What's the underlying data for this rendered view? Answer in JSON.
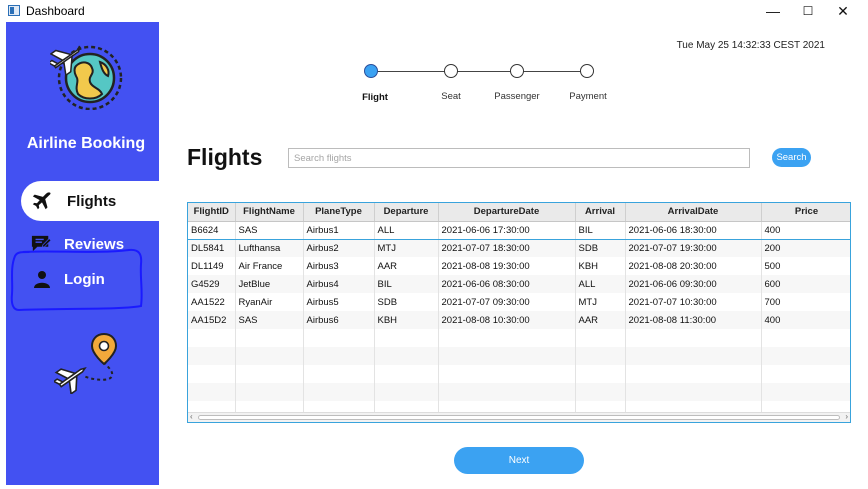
{
  "window": {
    "title": "Dashboard",
    "minimize": "—",
    "maximize": "☐",
    "close": "✕"
  },
  "sidebar": {
    "brand": "Airline Booking",
    "items": [
      {
        "label": "Flights",
        "icon": "plane-icon",
        "active": true
      },
      {
        "label": "Reviews",
        "icon": "reviews-icon",
        "active": false
      },
      {
        "label": "Login",
        "icon": "user-icon",
        "active": false
      }
    ],
    "colors": {
      "background": "#4351f2",
      "active_bg": "#ffffff"
    }
  },
  "header": {
    "datetime": "Tue May 25 14:32:33 CEST 2021"
  },
  "stepper": {
    "steps": [
      {
        "label": "Flight",
        "active": true
      },
      {
        "label": "Seat",
        "active": false
      },
      {
        "label": "Passenger",
        "active": false
      },
      {
        "label": "Payment",
        "active": false
      }
    ]
  },
  "main": {
    "title": "Flights",
    "search": {
      "placeholder": "Search flights",
      "value": "",
      "button_label": "Search"
    },
    "next_label": "Next"
  },
  "table": {
    "columns": [
      "FlightID",
      "FlightName",
      "PlaneType",
      "Departure",
      "DepartureDate",
      "Arrival",
      "ArrivalDate",
      "Price"
    ],
    "rows": [
      [
        "B6624",
        "SAS",
        "Airbus1",
        "ALL",
        "2021-06-06 17:30:00",
        "BIL",
        "2021-06-06 18:30:00",
        "400"
      ],
      [
        "DL5841",
        "Lufthansa",
        "Airbus2",
        "MTJ",
        "2021-07-07 18:30:00",
        "SDB",
        "2021-07-07 19:30:00",
        "200"
      ],
      [
        "DL1149",
        "Air France",
        "Airbus3",
        "AAR",
        "2021-08-08 19:30:00",
        "KBH",
        "2021-08-08 20:30:00",
        "500"
      ],
      [
        "G4529",
        "JetBlue",
        "Airbus4",
        "BIL",
        "2021-06-06 08:30:00",
        "ALL",
        "2021-06-06 09:30:00",
        "600"
      ],
      [
        "AA1522",
        "RyanAir",
        "Airbus5",
        "SDB",
        "2021-07-07 09:30:00",
        "MTJ",
        "2021-07-07 10:30:00",
        "700"
      ],
      [
        "AA15D2",
        "SAS",
        "Airbus6",
        "KBH",
        "2021-08-08 10:30:00",
        "AAR",
        "2021-08-08 11:30:00",
        "400"
      ]
    ],
    "empty_rows": 5,
    "selected_row": 0
  },
  "colors": {
    "accent": "#3ba2f2",
    "table_border": "#39a3dc",
    "annotation": "#1a1aff"
  }
}
